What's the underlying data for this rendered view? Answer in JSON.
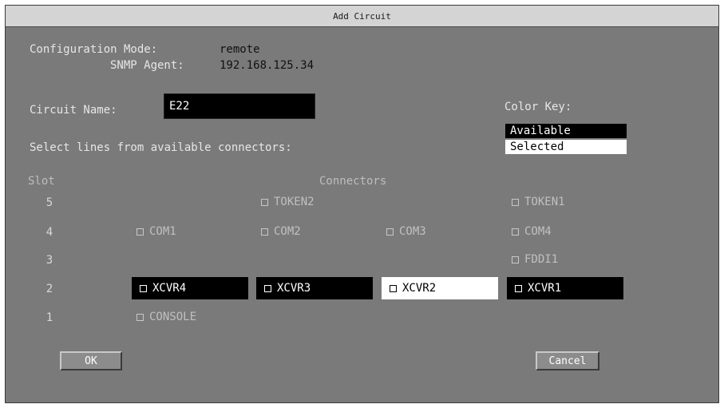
{
  "window": {
    "title": "Add Circuit"
  },
  "config": {
    "mode_label": "Configuration Mode:",
    "mode_value": "remote",
    "agent_label": "SNMP Agent:",
    "agent_value": "192.168.125.34"
  },
  "circuit": {
    "name_label": "Circuit Name:",
    "name_value": "E22"
  },
  "instructions": "Select lines from available connectors:",
  "color_key": {
    "title": "Color Key:",
    "available": "Available",
    "selected": "Selected"
  },
  "grid": {
    "slot_header": "Slot",
    "connectors_header": "Connectors",
    "slots": [
      "5",
      "4",
      "3",
      "2",
      "1"
    ]
  },
  "connectors": {
    "token2": "TOKEN2",
    "token1": "TOKEN1",
    "com1": "COM1",
    "com2": "COM2",
    "com3": "COM3",
    "com4": "COM4",
    "fddi1": "FDDI1",
    "xcvr4": "XCVR4",
    "xcvr3": "XCVR3",
    "xcvr2": "XCVR2",
    "xcvr1": "XCVR1",
    "console": "CONSOLE"
  },
  "buttons": {
    "ok": "OK",
    "cancel": "Cancel"
  },
  "colors": {
    "available": "#000000",
    "selected": "#ffffff",
    "unavailable": "#7a7a7a"
  }
}
